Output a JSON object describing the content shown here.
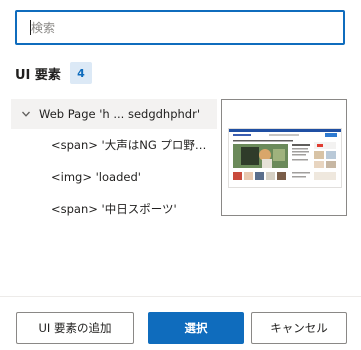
{
  "search": {
    "placeholder": "検索",
    "value": ""
  },
  "section": {
    "title": "UI 要素",
    "count": "4"
  },
  "tree": {
    "root": {
      "label": "Web Page 'h ... sedgdhphdr'",
      "expanded": true,
      "icon": "chevron-down-icon"
    },
    "children": [
      {
        "label": "<span> '大声はNG プロ野球キ..."
      },
      {
        "label": "<img> 'loaded'"
      },
      {
        "label": "<span> '中日スポーツ'"
      }
    ]
  },
  "buttons": {
    "add_label": "UI 要素の追加",
    "select_label": "選択",
    "cancel_label": "キャンセル"
  },
  "colors": {
    "accent": "#0f6cbd",
    "badge_bg": "#dce9f6",
    "selected_row": "#f3f2f1"
  }
}
